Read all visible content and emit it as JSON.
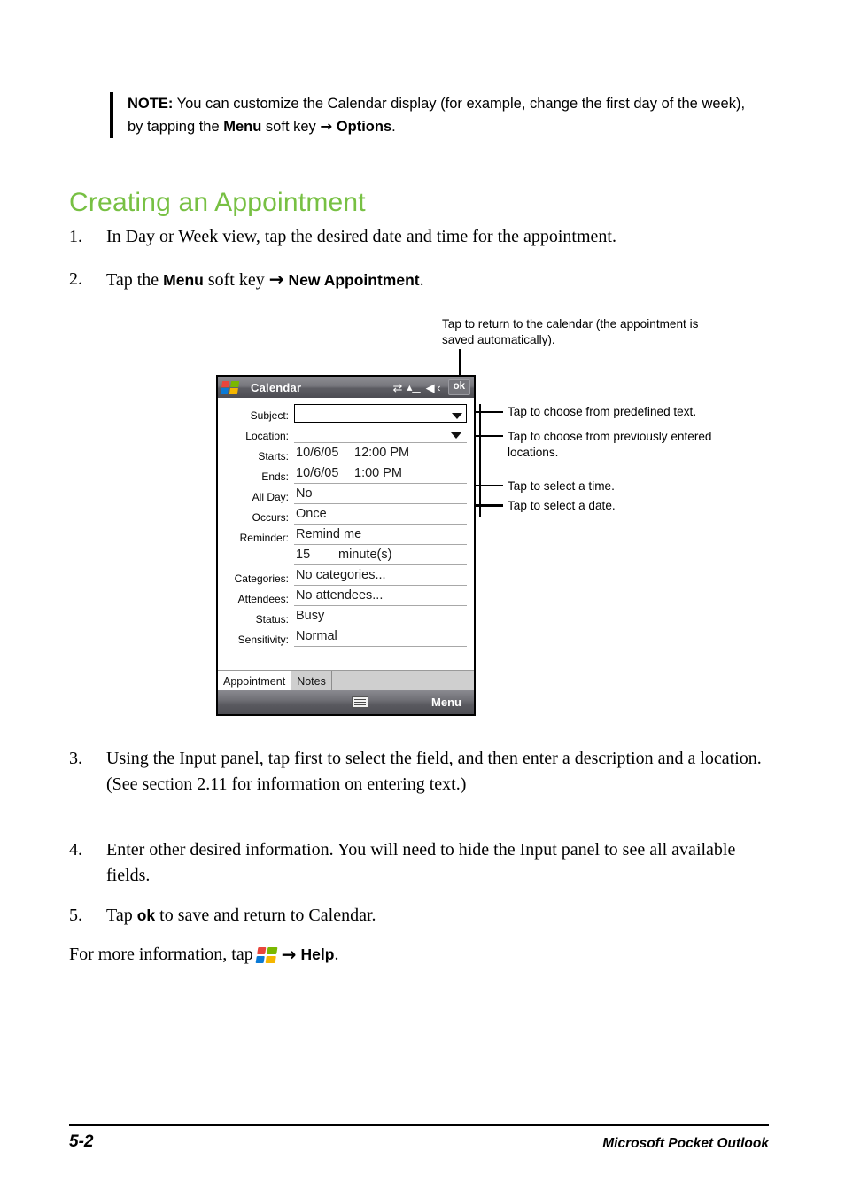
{
  "note": {
    "label": "NOTE:",
    "text_1": " You can customize the Calendar display (for example, change the first day of the week), by tapping the ",
    "bold_1": "Menu",
    "text_2": " soft key ",
    "arrow": "→",
    "bold_2": "Options",
    "text_3": "."
  },
  "heading": "Creating an Appointment",
  "steps": [
    {
      "num": "1.",
      "text_1": "In Day or Week view, tap the desired date and time for the appointment.",
      "bold_1": "",
      "text_2": "",
      "arrow": "",
      "bold_2": "",
      "text_3": ""
    },
    {
      "num": "2.",
      "text_1": "Tap the ",
      "bold_1": "Menu",
      "text_2": " soft key ",
      "arrow": "→",
      "bold_2": "New Appointment",
      "text_3": "."
    },
    {
      "num": "3.",
      "text_1": "Using the Input panel, tap first to select the field, and then enter a description and a location. (See section 2.11 for information on entering text.)",
      "bold_1": "",
      "text_2": "",
      "arrow": "",
      "bold_2": "",
      "text_3": ""
    },
    {
      "num": "4.",
      "text_1": "Enter other desired information. You will need to hide the Input panel to see all available fields.",
      "bold_1": "",
      "text_2": "",
      "arrow": "",
      "bold_2": "",
      "text_3": ""
    },
    {
      "num": "5.",
      "text_1": "Tap ",
      "bold_1": "ok",
      "text_2": " to save and return to Calendar.",
      "arrow": "",
      "bold_2": "",
      "text_3": ""
    }
  ],
  "closing": {
    "text_1": "For more information, tap ",
    "icon": "windows-start-flag-icon",
    "arrow": "→",
    "bold_1": "Help",
    "text_2": "."
  },
  "callouts": {
    "ok_button": "Tap to return to the calendar (the appointment is saved automatically).",
    "predefined_text": "Tap to choose from predefined text.",
    "locations": "Tap to choose from previously entered locations.",
    "select_time": "Tap to select a time.",
    "select_date": "Tap to select a date."
  },
  "pda": {
    "titlebar": {
      "start_icon": "windows-start-flag-icon",
      "title": "Calendar",
      "icons": [
        {
          "name": "connectivity-icon",
          "glyph": "⇆"
        },
        {
          "name": "signal-strength-icon",
          "glyph": "▮"
        },
        {
          "name": "volume-icon",
          "glyph": "◂"
        }
      ],
      "ok_label": "ok"
    },
    "fields": [
      {
        "label": "Subject:",
        "value": "",
        "style": "boxed",
        "caret": "dropdown-caret-icon"
      },
      {
        "label": "Location:",
        "value": "",
        "style": "plain",
        "caret": "dropdown-caret-icon"
      },
      {
        "label": "Starts:",
        "date": "10/6/05",
        "time": "12:00 PM",
        "style": "datetime",
        "caret": ""
      },
      {
        "label": "Ends:",
        "date": "10/6/05",
        "time": "1:00 PM",
        "style": "datetime",
        "caret": ""
      },
      {
        "label": "All Day:",
        "value": "No",
        "style": "plain",
        "caret": ""
      },
      {
        "label": "Occurs:",
        "value": "Once",
        "style": "plain",
        "caret": ""
      },
      {
        "label": "Reminder:",
        "value": "Remind me",
        "style": "plain",
        "caret": ""
      },
      {
        "label": "",
        "num": "15",
        "unit": "minute(s)",
        "style": "numunit",
        "caret": ""
      },
      {
        "label": "Categories:",
        "value": "No categories...",
        "style": "plain",
        "caret": ""
      },
      {
        "label": "Attendees:",
        "value": "No attendees...",
        "style": "plain",
        "caret": ""
      },
      {
        "label": "Status:",
        "value": "Busy",
        "style": "plain",
        "caret": ""
      },
      {
        "label": "Sensitivity:",
        "value": "Normal",
        "style": "plain",
        "caret": ""
      }
    ],
    "tabs": [
      {
        "label": "Appointment",
        "active": true
      },
      {
        "label": "Notes",
        "active": false
      }
    ],
    "menubar": {
      "keyboard_icon": "input-panel-keyboard-icon",
      "menu_label": "Menu"
    }
  },
  "footer": {
    "page_number": "5-2",
    "book_title": "Microsoft Pocket Outlook"
  },
  "colors": {
    "heading_green": "#77c043",
    "titlebar_gray": "#707076",
    "tab_gray": "#cfcfcf"
  }
}
